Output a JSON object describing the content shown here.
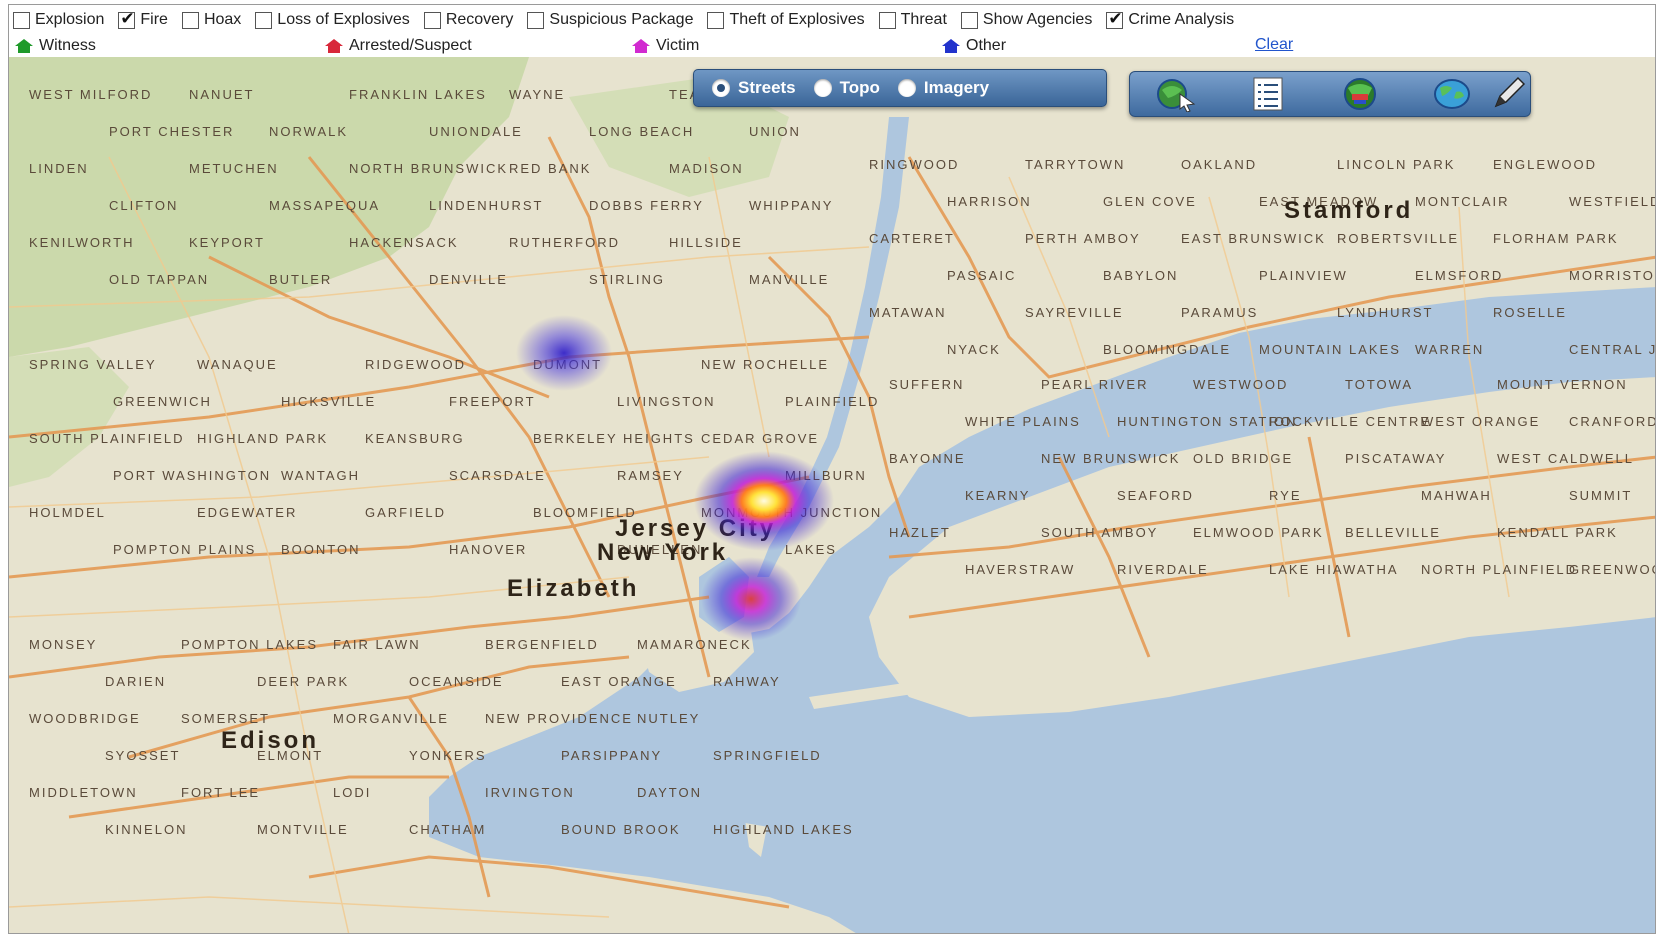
{
  "filters": [
    {
      "label": "Explosion",
      "checked": false
    },
    {
      "label": "Fire",
      "checked": true
    },
    {
      "label": "Hoax",
      "checked": false
    },
    {
      "label": "Loss of Explosives",
      "checked": false
    },
    {
      "label": "Recovery",
      "checked": false
    },
    {
      "label": "Suspicious Package",
      "checked": false
    },
    {
      "label": "Theft of Explosives",
      "checked": false
    },
    {
      "label": "Threat",
      "checked": false
    },
    {
      "label": "Show Agencies",
      "checked": false
    },
    {
      "label": "Crime Analysis",
      "checked": true
    }
  ],
  "legend": [
    {
      "label": "Witness",
      "color": "#1f9a2a"
    },
    {
      "label": "Arrested/Suspect",
      "color": "#d8283a"
    },
    {
      "label": "Victim",
      "color": "#d12ad0"
    },
    {
      "label": "Other",
      "color": "#2233cc"
    }
  ],
  "clear_label": "Clear",
  "basemap": {
    "options": [
      "Streets",
      "Topo",
      "Imagery"
    ],
    "selected": "Streets"
  },
  "toolbar": {
    "tools": [
      "select-globe-icon",
      "list-icon",
      "layers-globe-icon",
      "world-globe-icon",
      "pencil-icon"
    ]
  },
  "map": {
    "cities": [
      "Stamford",
      "Jersey City",
      "New York",
      "Elizabeth",
      "Edison"
    ],
    "places": [
      "West Milford",
      "Ringwood",
      "Suffern",
      "Spring Valley",
      "Monsey",
      "Nanuet",
      "Tarrytown",
      "Pearl River",
      "Wanaque",
      "Pompton Lakes",
      "Franklin Lakes",
      "Oakland",
      "Westwood",
      "Ridgewood",
      "Fair Lawn",
      "Wayne",
      "Lincoln Park",
      "Totowa",
      "Dumont",
      "Bergenfield",
      "Teaneck",
      "Englewood",
      "Mount Vernon",
      "New Rochelle",
      "Mamaroneck",
      "Port Chester",
      "Harrison",
      "White Plains",
      "Greenwich",
      "Darien",
      "Norwalk",
      "Glen Cove",
      "Huntington Station",
      "Hicksville",
      "Deer Park",
      "Uniondale",
      "East Meadow",
      "Rockville Centre",
      "Freeport",
      "Oceanside",
      "Long Beach",
      "Montclair",
      "West Orange",
      "Livingston",
      "East Orange",
      "Union",
      "Westfield",
      "Cranford",
      "Plainfield",
      "Rahway",
      "Linden",
      "Carteret",
      "Bayonne",
      "South Plainfield",
      "Woodbridge",
      "Metuchen",
      "Perth Amboy",
      "New Brunswick",
      "Highland Park",
      "Somerset",
      "North Brunswick",
      "East Brunswick",
      "Old Bridge",
      "Keansburg",
      "Morganville",
      "Red Bank",
      "Robertsville",
      "Piscataway",
      "Berkeley Heights",
      "New Providence",
      "Madison",
      "Florham Park",
      "West Caldwell",
      "Cedar Grove",
      "Nutley",
      "Clifton",
      "Passaic",
      "Kearny",
      "Port Washington",
      "Syosset",
      "Massapequa",
      "Babylon",
      "Seaford",
      "Wantagh",
      "Elmont",
      "Lindenhurst",
      "Plainview",
      "Rye",
      "Scarsdale",
      "Yonkers",
      "Dobbs Ferry",
      "Elmsford",
      "Mahwah",
      "Ramsey",
      "Parsippany",
      "Whippany",
      "Morristown",
      "Summit",
      "Millburn",
      "Springfield",
      "Kenilworth",
      "Matawan",
      "Hazlet",
      "Holmdel",
      "Middletown",
      "Keyport",
      "Sayreville",
      "South Amboy",
      "Edgewater",
      "Fort Lee",
      "Hackensack",
      "Paramus",
      "Elmwood Park",
      "Garfield",
      "Lodi",
      "Rutherford",
      "Lyndhurst",
      "Belleville",
      "Bloomfield",
      "Irvington",
      "Hillside",
      "Roselle",
      "Kendall Park",
      "Monmouth Junction",
      "Dayton",
      "Old Tappan",
      "Nyack",
      "Haverstraw",
      "Pompton Plains",
      "Kinnelon",
      "Butler",
      "Bloomingdale",
      "Riverdale",
      "Boonton",
      "Montville",
      "Denville",
      "Mountain Lakes",
      "Lake Hiawatha",
      "Hanover",
      "Chatham",
      "Stirling",
      "Warren",
      "North Plainfield",
      "Dunellen",
      "Bound Brook",
      "Manville",
      "Central Jersey Regional Airport",
      "Greenwood Lake",
      "Lakes",
      "Highland Lakes"
    ]
  }
}
